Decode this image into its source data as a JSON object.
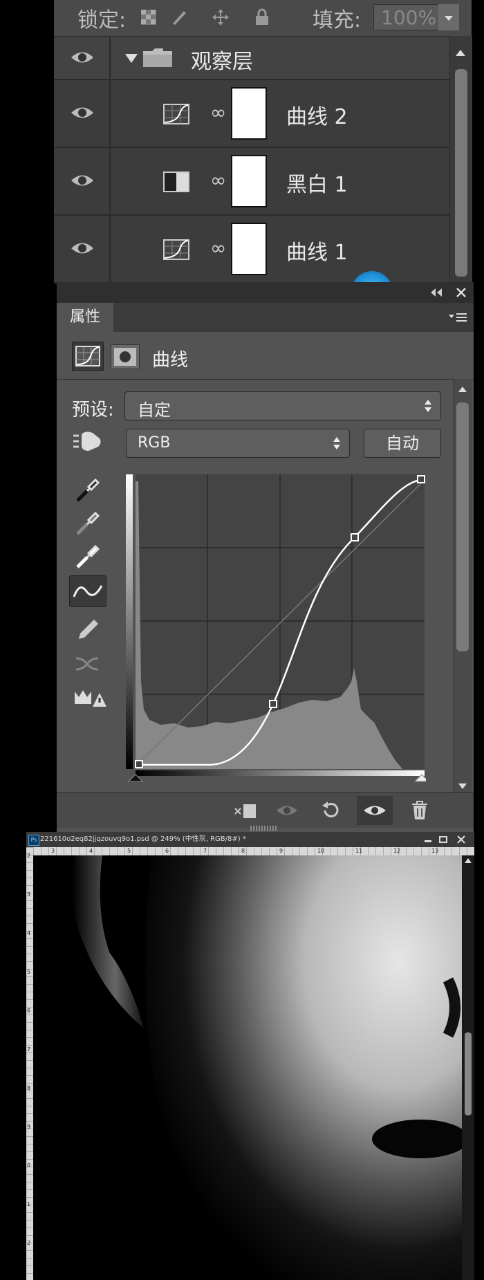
{
  "layers_panel": {
    "lock_label": "锁定:",
    "fill_label": "填充:",
    "fill_value": "100%",
    "layers": [
      {
        "name": "观察层",
        "type": "group"
      },
      {
        "name": "曲线 2",
        "type": "curves"
      },
      {
        "name": "黑白 1",
        "type": "black-white"
      },
      {
        "name": "曲线 1",
        "type": "curves"
      }
    ]
  },
  "properties_panel": {
    "tab": "属性",
    "adjustment_name": "曲线",
    "preset_label": "预设:",
    "preset_value": "自定",
    "channel_value": "RGB",
    "auto_button": "自动",
    "tools": [
      "eyedropper-black-icon",
      "eyedropper-gray-icon",
      "eyedropper-white-icon",
      "curve-points-icon",
      "pencil-icon",
      "smooth-icon",
      "clipping-warning-icon"
    ],
    "curve_points": [
      [
        0,
        0
      ],
      [
        255,
        255
      ]
    ],
    "bottom_icons": [
      "clip-to-layer-icon",
      "view-previous-icon",
      "reset-icon",
      "visibility-icon",
      "delete-icon"
    ]
  },
  "document": {
    "title": "221610o2eq82jjqzouvq9o1.psd @ 249% (中性灰, RGB/8#) *",
    "ruler_top": [
      "3",
      "4",
      "5",
      "6",
      "7",
      "8",
      "9",
      "10",
      "11",
      "12",
      "13"
    ],
    "ruler_left": [
      "2",
      "3",
      "4",
      "5",
      "6",
      "7",
      "8",
      "9",
      "0",
      "1",
      "2"
    ]
  },
  "colors": {
    "panel_bg": "#535353",
    "layers_bg": "#3c3c3c",
    "accent_blue": "#1e90d6"
  }
}
